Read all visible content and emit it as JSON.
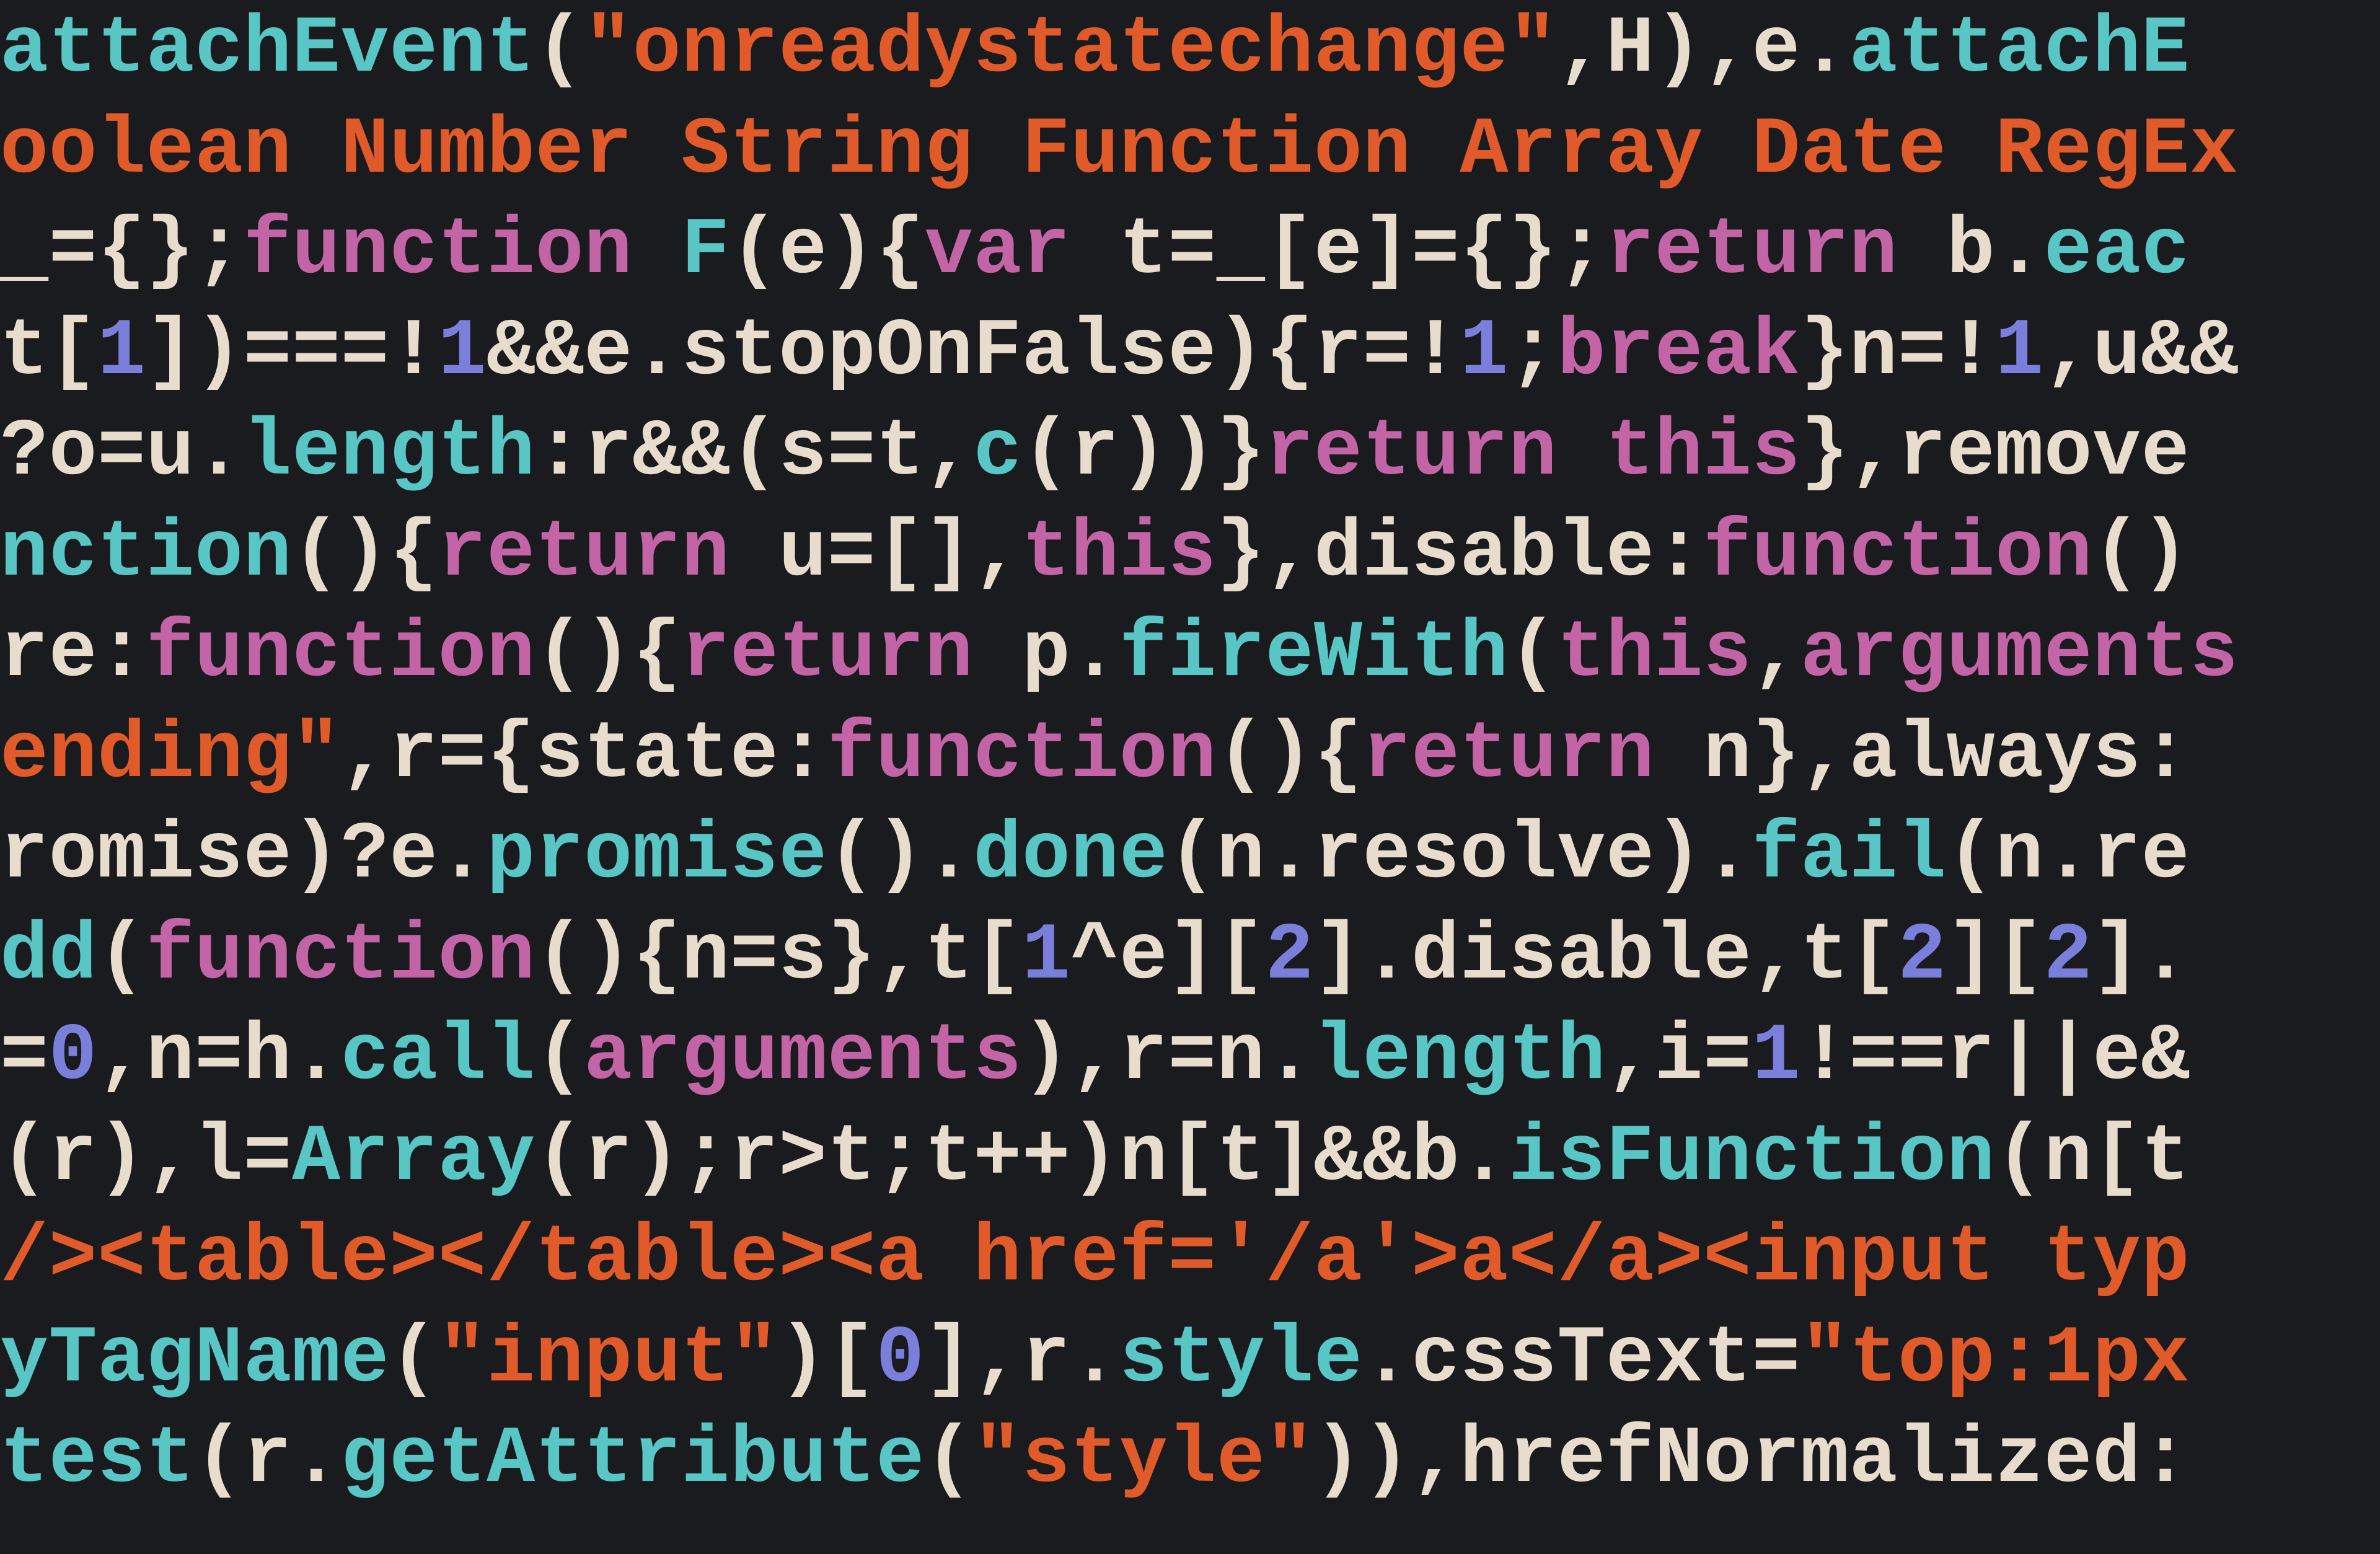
{
  "editor": {
    "language": "javascript",
    "theme": "dark",
    "lines": [
      [
        {
          "c": "fn",
          "t": "attachEvent"
        },
        {
          "c": "pn",
          "t": "("
        },
        {
          "c": "str",
          "t": "\"onreadystatechange\""
        },
        {
          "c": "pn",
          "t": ",H),e."
        },
        {
          "c": "fn",
          "t": "attachE"
        }
      ],
      [
        {
          "c": "str",
          "t": "oolean Number String Function Array Date RegEx"
        }
      ],
      [
        {
          "c": "id",
          "t": "_={};"
        },
        {
          "c": "kw",
          "t": "function"
        },
        {
          "c": "id",
          "t": " "
        },
        {
          "c": "fn",
          "t": "F"
        },
        {
          "c": "id",
          "t": "(e){"
        },
        {
          "c": "kw",
          "t": "var"
        },
        {
          "c": "id",
          "t": " t=_[e]={};"
        },
        {
          "c": "kw",
          "t": "return"
        },
        {
          "c": "id",
          "t": " b."
        },
        {
          "c": "fn",
          "t": "eac"
        }
      ],
      [
        {
          "c": "id",
          "t": "t["
        },
        {
          "c": "num",
          "t": "1"
        },
        {
          "c": "id",
          "t": "])===!"
        },
        {
          "c": "num",
          "t": "1"
        },
        {
          "c": "id",
          "t": "&&e.stopOnFalse){r=!"
        },
        {
          "c": "num",
          "t": "1"
        },
        {
          "c": "id",
          "t": ";"
        },
        {
          "c": "kw",
          "t": "break"
        },
        {
          "c": "id",
          "t": "}n=!"
        },
        {
          "c": "num",
          "t": "1"
        },
        {
          "c": "id",
          "t": ",u&&"
        }
      ],
      [
        {
          "c": "id",
          "t": "?o=u."
        },
        {
          "c": "fn",
          "t": "length"
        },
        {
          "c": "id",
          "t": ":r&&(s=t,"
        },
        {
          "c": "fn",
          "t": "c"
        },
        {
          "c": "id",
          "t": "(r))}"
        },
        {
          "c": "kw",
          "t": "return this"
        },
        {
          "c": "id",
          "t": "},remove"
        }
      ],
      [
        {
          "c": "fn",
          "t": "nction"
        },
        {
          "c": "id",
          "t": "(){"
        },
        {
          "c": "kw",
          "t": "return"
        },
        {
          "c": "id",
          "t": " u=[],"
        },
        {
          "c": "kw",
          "t": "this"
        },
        {
          "c": "id",
          "t": "},disable:"
        },
        {
          "c": "kw",
          "t": "function"
        },
        {
          "c": "id",
          "t": "()"
        }
      ],
      [
        {
          "c": "id",
          "t": "re:"
        },
        {
          "c": "kw",
          "t": "function"
        },
        {
          "c": "id",
          "t": "(){"
        },
        {
          "c": "kw",
          "t": "return"
        },
        {
          "c": "id",
          "t": " p."
        },
        {
          "c": "fn",
          "t": "fireWith"
        },
        {
          "c": "id",
          "t": "("
        },
        {
          "c": "kw",
          "t": "this"
        },
        {
          "c": "id",
          "t": ","
        },
        {
          "c": "kw",
          "t": "arguments"
        }
      ],
      [
        {
          "c": "str",
          "t": "ending\""
        },
        {
          "c": "id",
          "t": ",r={state:"
        },
        {
          "c": "kw",
          "t": "function"
        },
        {
          "c": "id",
          "t": "(){"
        },
        {
          "c": "kw",
          "t": "return"
        },
        {
          "c": "id",
          "t": " n},always:"
        }
      ],
      [
        {
          "c": "id",
          "t": "romise)?e."
        },
        {
          "c": "fn",
          "t": "promise"
        },
        {
          "c": "id",
          "t": "()."
        },
        {
          "c": "fn",
          "t": "done"
        },
        {
          "c": "id",
          "t": "(n.resolve)."
        },
        {
          "c": "fn",
          "t": "fail"
        },
        {
          "c": "id",
          "t": "(n.re"
        }
      ],
      [
        {
          "c": "fn",
          "t": "dd"
        },
        {
          "c": "id",
          "t": "("
        },
        {
          "c": "kw",
          "t": "function"
        },
        {
          "c": "id",
          "t": "(){n=s},t["
        },
        {
          "c": "num",
          "t": "1"
        },
        {
          "c": "id",
          "t": "^e]["
        },
        {
          "c": "num",
          "t": "2"
        },
        {
          "c": "id",
          "t": "].disable,t["
        },
        {
          "c": "num",
          "t": "2"
        },
        {
          "c": "id",
          "t": "]["
        },
        {
          "c": "num",
          "t": "2"
        },
        {
          "c": "id",
          "t": "]."
        }
      ],
      [
        {
          "c": "id",
          "t": "="
        },
        {
          "c": "num",
          "t": "0"
        },
        {
          "c": "id",
          "t": ",n=h."
        },
        {
          "c": "fn",
          "t": "call"
        },
        {
          "c": "id",
          "t": "("
        },
        {
          "c": "kw",
          "t": "arguments"
        },
        {
          "c": "id",
          "t": "),r=n."
        },
        {
          "c": "fn",
          "t": "length"
        },
        {
          "c": "id",
          "t": ",i="
        },
        {
          "c": "num",
          "t": "1"
        },
        {
          "c": "id",
          "t": "!==r||e&"
        }
      ],
      [
        {
          "c": "id",
          "t": "(r),l="
        },
        {
          "c": "fn",
          "t": "Array"
        },
        {
          "c": "id",
          "t": "(r);r>t;t++)n[t]&&b."
        },
        {
          "c": "fn",
          "t": "isFunction"
        },
        {
          "c": "id",
          "t": "(n[t"
        }
      ],
      [
        {
          "c": "str",
          "t": "/><table></table><a href='/a'>a</a><input typ"
        }
      ],
      [
        {
          "c": "fn",
          "t": "yTagName"
        },
        {
          "c": "id",
          "t": "("
        },
        {
          "c": "str",
          "t": "\"input\""
        },
        {
          "c": "id",
          "t": ")["
        },
        {
          "c": "num",
          "t": "0"
        },
        {
          "c": "id",
          "t": "],r."
        },
        {
          "c": "fn",
          "t": "style"
        },
        {
          "c": "id",
          "t": ".cssText="
        },
        {
          "c": "str",
          "t": "\"top:1px"
        }
      ],
      [
        {
          "c": "fn",
          "t": "test"
        },
        {
          "c": "id",
          "t": "(r."
        },
        {
          "c": "fn",
          "t": "getAttribute"
        },
        {
          "c": "id",
          "t": "("
        },
        {
          "c": "str",
          "t": "\"style\""
        },
        {
          "c": "id",
          "t": ")),hrefNormalized:"
        }
      ]
    ]
  }
}
